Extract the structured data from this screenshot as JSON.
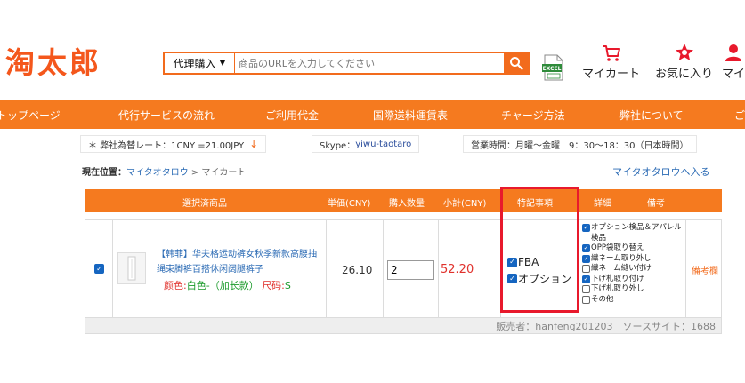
{
  "header": {
    "logo": "淘太郎",
    "search_select": "代理購入",
    "search_placeholder": "商品のURLを入力してください",
    "excel_label": "EXCEL",
    "links": [
      "マイカート",
      "お気に入り",
      "マイ"
    ]
  },
  "nav": {
    "items": [
      "トップページ",
      "代行サービスの流れ",
      "ご利用代金",
      "国際送料運賃表",
      "チャージ方法",
      "弊社について",
      "ご"
    ]
  },
  "info": {
    "rate": "＊ 弊社為替レート：1CNY =21.00JPY",
    "skype_label": "Skype：",
    "skype_id": "yiwu-taotaro",
    "hours": "営業時間：月曜～金曜　9：30～18：30（日本時間）"
  },
  "breadcrumb": {
    "label": "現在位置：",
    "home": "マイタオタロウ",
    "sep": " > ",
    "current": "マイカート",
    "back_link": "マイタオタロウへ入る"
  },
  "table": {
    "headers": [
      "選択済商品",
      "単価(CNY)",
      "購入数量",
      "小計(CNY)",
      "特記事項",
      "詳細",
      "備考"
    ],
    "row": {
      "title": "【韩菲】华夫格运动裤女秋季新款高腰抽绳束脚裤百搭休闲阔腿裤子",
      "opt_color_label": "颜色:",
      "opt_color_value": "白色-（加长款）",
      "opt_size_label": "尺码:",
      "opt_size_value": "S",
      "unit_price": "26.10",
      "quantity": "2",
      "subtotal": "52.20",
      "special": [
        {
          "label": "FBA",
          "checked": true
        },
        {
          "label": "オプション",
          "checked": true
        }
      ],
      "details": [
        {
          "label": "オプション検品＆アパレル検品",
          "checked": true
        },
        {
          "label": "OPP袋取り替え",
          "checked": true
        },
        {
          "label": "織ネーム取り外し",
          "checked": true
        },
        {
          "label": "織ネーム縫い付け",
          "checked": false
        },
        {
          "label": "下げ札取り付け",
          "checked": true
        },
        {
          "label": "下げ札取り外し",
          "checked": false
        },
        {
          "label": "その他",
          "checked": false
        }
      ],
      "memo": "備考欄"
    },
    "footer": "販売者：hanfeng201203　ソースサイト：1688"
  }
}
